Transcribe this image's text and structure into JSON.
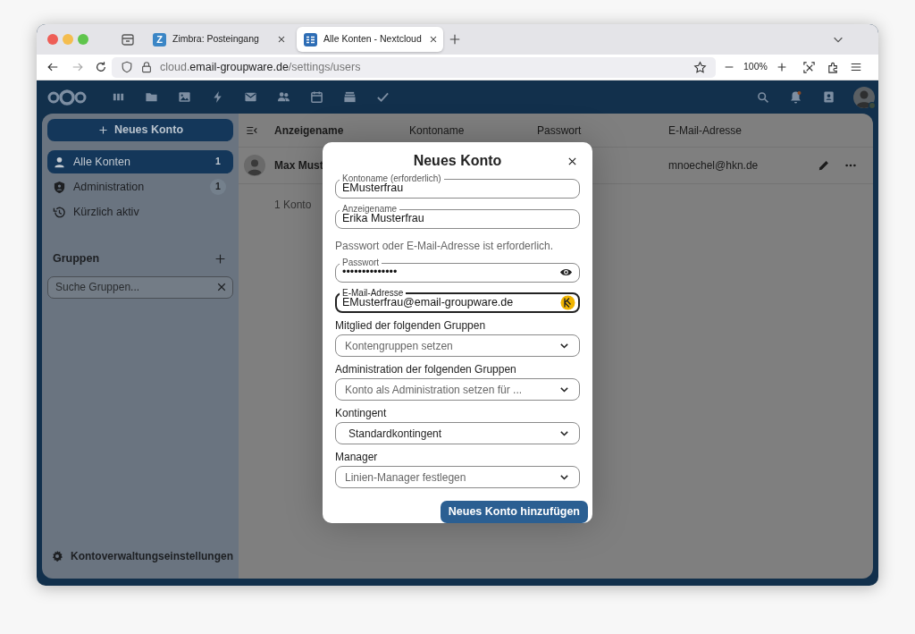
{
  "browser": {
    "tabs": [
      {
        "title": "Zimbra: Posteingang",
        "favicon_letter": "Z",
        "selected": false
      },
      {
        "title": "Alle Konten - Nextcloud",
        "selected": true
      }
    ],
    "url": {
      "prefix": "cloud.",
      "domain": "email-groupware.de",
      "path": "/settings/users"
    },
    "zoom": "100%"
  },
  "sidebar": {
    "new_button": "Neues Konto",
    "items": [
      {
        "label": "Alle Konten",
        "count": "1",
        "selected": true
      },
      {
        "label": "Administration",
        "count": "1",
        "selected": false
      },
      {
        "label": "Kürzlich aktiv",
        "selected": false
      }
    ],
    "groups_title": "Gruppen",
    "group_search": {
      "placeholder": "Suche Gruppen..."
    },
    "settings": "Kontoverwaltungseinstellungen"
  },
  "table": {
    "columns": [
      "Anzeigename",
      "Kontoname",
      "Passwort",
      "E-Mail-Adresse"
    ],
    "rows": [
      {
        "display_name": "Max Must",
        "email": "mnoechel@hkn.de"
      }
    ],
    "footer": "1 Konto"
  },
  "dialog": {
    "title": "Neues Konto",
    "items": [
      {
        "kind": "input",
        "label": "Kontoname (erforderlich)",
        "value": "EMusterfrau",
        "focused": false
      },
      {
        "kind": "input",
        "label": "Anzeigename",
        "value": "Erika Musterfrau",
        "focused": false
      },
      {
        "kind": "hint",
        "text": "Passwort oder E-Mail-Adresse ist erforderlich."
      },
      {
        "kind": "password",
        "label": "Passwort",
        "value": "••••••••••••••",
        "focused": false
      },
      {
        "kind": "input",
        "label": "E-Mail-Adresse",
        "value": "EMusterfrau@email-groupware.de",
        "focused": true
      },
      {
        "kind": "select",
        "label": "Mitglied der folgenden Gruppen",
        "placeholder": "Kontengruppen setzen"
      },
      {
        "kind": "select",
        "label": "Administration der folgenden Gruppen",
        "placeholder": "Konto als Administration setzen für ..."
      },
      {
        "kind": "select",
        "label": "Kontingent",
        "value": "Standardkontingent"
      },
      {
        "kind": "select",
        "label": "Manager",
        "placeholder": "Linien-Manager festlegen"
      }
    ],
    "submit": "Neues Konto hinzufügen"
  }
}
